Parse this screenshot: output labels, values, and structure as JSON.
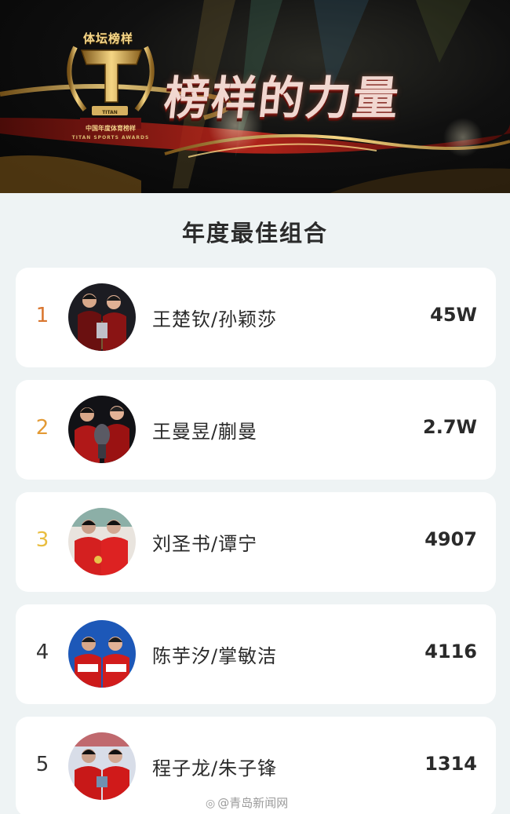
{
  "banner": {
    "title": "榜样的力量",
    "trophy_badge": "体坛榜样",
    "trophy_tag": "TITAN",
    "trophy_sub_cn": "中国年度体育榜样",
    "trophy_sub_en": "TITAN SPORTS AWARDS"
  },
  "section": {
    "title": "年度最佳组合"
  },
  "colors": {
    "rank_1": "#d9762f",
    "rank_2": "#e39a35",
    "rank_3": "#e9bd3f",
    "rank_default": "#333333"
  },
  "ranking": [
    {
      "rank": "1",
      "name": "王楚钦/孙颖莎",
      "score": "45W",
      "avatar": "two-athletes-avatar-dark"
    },
    {
      "rank": "2",
      "name": "王曼昱/蒯曼",
      "score": "2.7W",
      "avatar": "two-athletes-avatar-dark"
    },
    {
      "rank": "3",
      "name": "刘圣书/谭宁",
      "score": "4907",
      "avatar": "two-athletes-avatar-red"
    },
    {
      "rank": "4",
      "name": "陈芋汐/掌敏洁",
      "score": "4116",
      "avatar": "two-athletes-avatar-blue"
    },
    {
      "rank": "5",
      "name": "程子龙/朱子锋",
      "score": "1314",
      "avatar": "two-athletes-avatar-light"
    }
  ],
  "watermark": {
    "text": "@青岛新闻网",
    "logo": "weibo-icon"
  }
}
